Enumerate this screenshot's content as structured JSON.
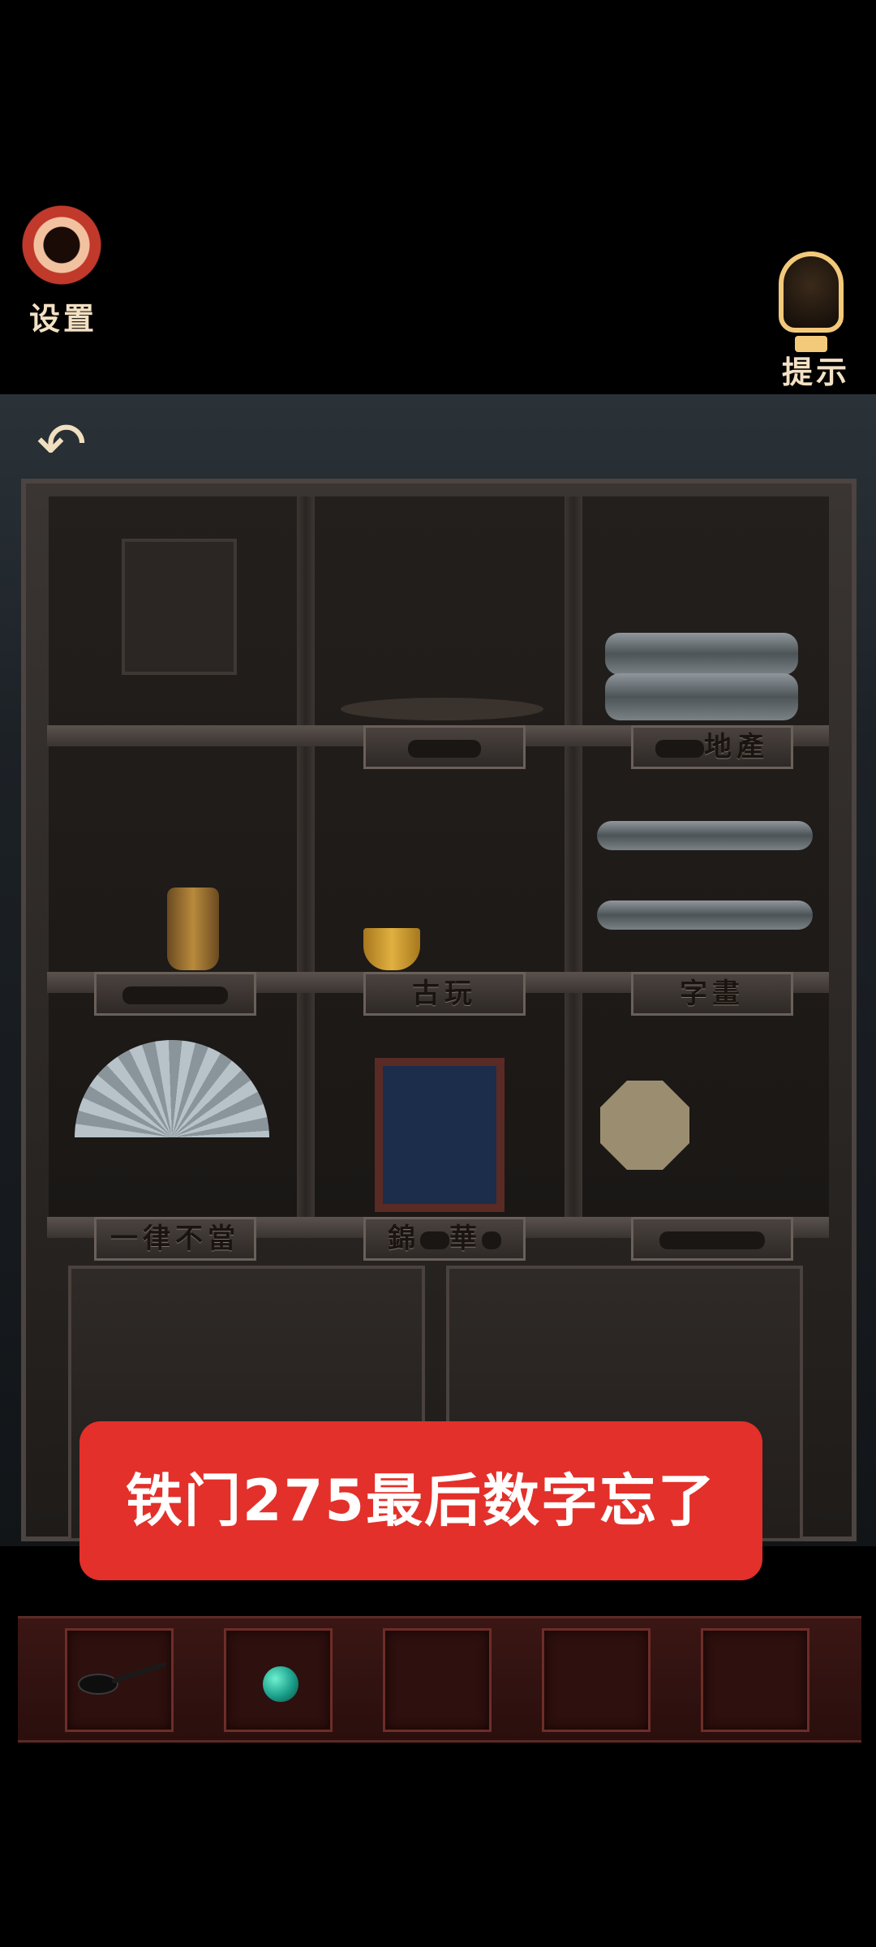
{
  "top_bar": {
    "settings_label": "设置",
    "hint_label": "提示"
  },
  "cabinet": {
    "plaques": {
      "row1_middle": "",
      "row1_right": "地產",
      "row2_left": "",
      "row2_middle": "古玩",
      "row2_right": "字畫",
      "row3_left": "一律不當",
      "row3_middle_a": "錦",
      "row3_middle_b": "華",
      "row3_right": ""
    }
  },
  "message": {
    "text": "铁门275最后数字忘了"
  },
  "inventory": {
    "slots": [
      {
        "item": "spoon-icon"
      },
      {
        "item": "jade-bead-icon"
      },
      {
        "item": ""
      },
      {
        "item": ""
      },
      {
        "item": ""
      }
    ]
  },
  "colors": {
    "message_bg": "#e3302a",
    "label_text": "#f3e1c3",
    "inventory_frame": "#6e2d28"
  }
}
